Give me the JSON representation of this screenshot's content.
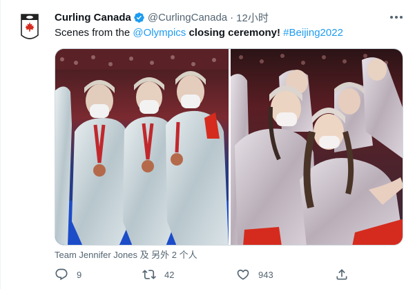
{
  "tweet": {
    "author": {
      "name": "Curling Canada",
      "handle": "@CurlingCanada",
      "separator": "·",
      "time": "12小时",
      "verified": true,
      "avatar_icon": "curling-canada-logo-icon"
    },
    "text": {
      "part1": "Scenes from the ",
      "mention": "@Olympics",
      "part2": " closing ceremony! ",
      "hashtag": "#Beijing2022"
    },
    "media": {
      "photos": [
        {
          "description_icon": "photo-athletes-with-medals"
        },
        {
          "description_icon": "photo-athletes-selfie"
        }
      ]
    },
    "tagged": "Team Jennifer Jones 及 另外 2 个人",
    "actions": {
      "replies": "9",
      "retweets": "42",
      "likes": "943",
      "share_icon": "share-icon"
    },
    "colors": {
      "link": "#1d9bf0",
      "verified": "#1d9bf0",
      "secondary_text": "#536471",
      "canada_red": "#d52b1e"
    }
  }
}
